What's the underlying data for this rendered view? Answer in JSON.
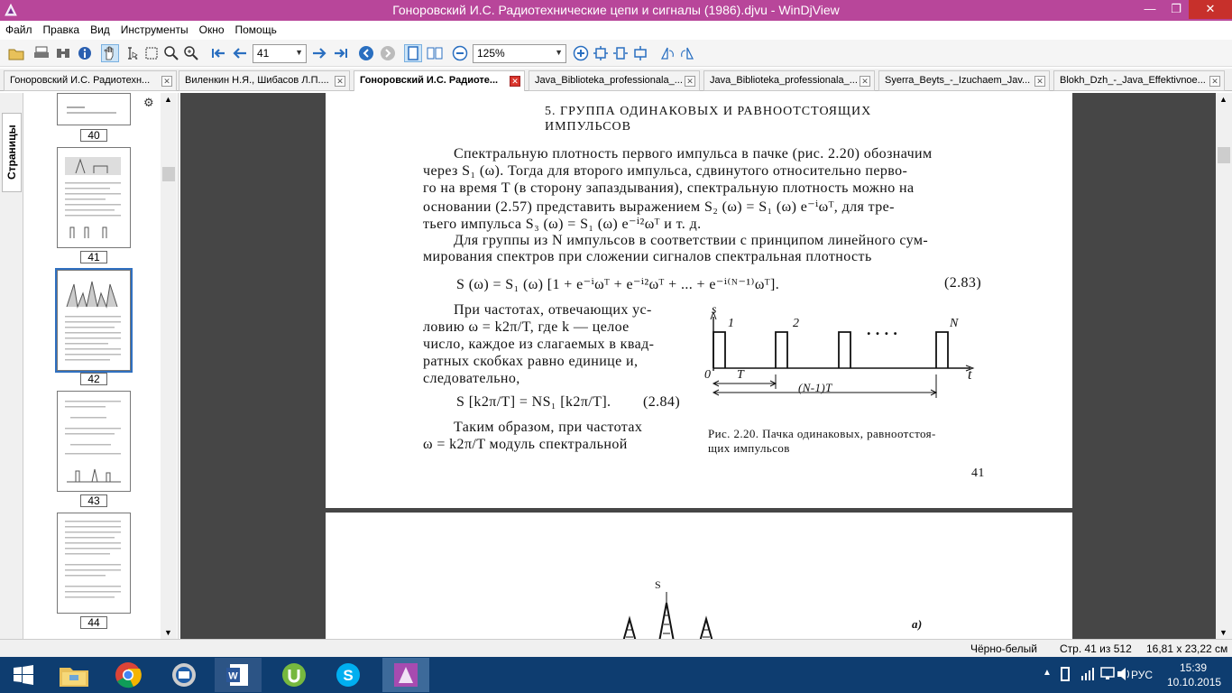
{
  "window": {
    "title": "Гоноровский И.С. Радиотехнические цепи и сигналы (1986).djvu - WinDjView"
  },
  "menu": [
    "Файл",
    "Правка",
    "Вид",
    "Инструменты",
    "Окно",
    "Помощь"
  ],
  "toolbar": {
    "page_value": "41",
    "zoom_value": "125%"
  },
  "tabs": [
    {
      "label": "Гоноровский И.С. Радиотехн..."
    },
    {
      "label": "Виленкин Н.Я., Шибасов Л.П...."
    },
    {
      "label": "Гоноровский И.С. Радиоте..."
    },
    {
      "label": "Java_Biblioteka_professionala_..."
    },
    {
      "label": "Java_Biblioteka_professionala_..."
    },
    {
      "label": "Syerra_Beyts_-_Izuchaem_Jav..."
    },
    {
      "label": "Blokh_Dzh_-_Java_Effektivnoe..."
    }
  ],
  "sidebar": {
    "tab_label": "Страницы",
    "thumbs": [
      "40",
      "41",
      "42",
      "43",
      "44"
    ]
  },
  "document": {
    "heading1": "5. ГРУППА ОДИНАКОВЫХ И РАВНООТСТОЯЩИХ",
    "heading2": "ИМПУЛЬСОВ",
    "lines": [
      "Спектральную плотность первого импульса в пачке (рис. 2.20) обозначим",
      "через S₁ (ω). Тогда для второго импульса, сдвинутого относительно перво-",
      "го на время T (в сторону запаздывания), спектральную плотность можно на",
      "основании (2.57) представить выражением S₂ (ω) = S₁ (ω) e⁻ⁱωᵀ, для тре-",
      "тьего   импульса   S₃ (ω) = S₁ (ω) e⁻ⁱ²ωᵀ   и   т.  д.",
      "Для группы из N импульсов в соответствии с принципом линейного сум-",
      "мирования спектров при сложении сигналов спектральная плотность"
    ],
    "formula1": "S (ω) = S₁ (ω) [1 + e⁻ⁱωᵀ + e⁻ⁱ²ωᵀ + ... + e⁻ⁱ⁽ᴺ⁻¹⁾ωᵀ].",
    "formula1_num": "(2.83)",
    "left_lines": [
      "При частотах, отвечающих ус-",
      "ловию   ω = k2π/T,  где k — целое",
      "число, каждое из слагаемых в квад-",
      "ратных  скобках  равно единице и,",
      "следовательно,"
    ],
    "formula2": "S [k2π/T] = NS₁ [k2π/T].",
    "formula2_num": "(2.84)",
    "left_lines2": [
      "Таким  образом,  при частотах",
      "ω = k2π/T   модуль   спектральной"
    ],
    "figure": {
      "axis_y": "s",
      "axis_x": "t",
      "origin": "0",
      "pulse_labels": [
        "1",
        "2",
        "N"
      ],
      "dots": ". . . .",
      "T_label": "T",
      "NT_label": "(N-1)T"
    },
    "caption1": "Рис. 2.20. Пачка одинаковых, равноотстоя-",
    "caption2": "щих импульсов",
    "page_number": "41",
    "next_page": {
      "axis_label": "S",
      "sub_label": "a)"
    }
  },
  "status": {
    "mode": "Чёрно-белый",
    "page": "Стр. 41 из 512",
    "size": "16,81 x 23,22 см"
  },
  "taskbar": {
    "lang": "РУС",
    "time": "15:39",
    "date": "10.10.2015"
  }
}
